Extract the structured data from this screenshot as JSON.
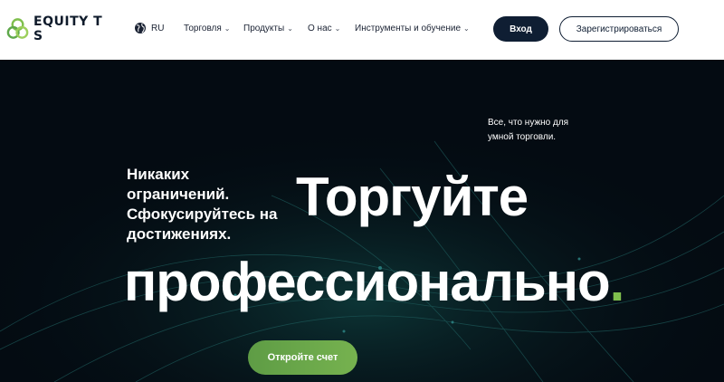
{
  "header": {
    "logo_text": "EQUITY T S",
    "language": "RU",
    "nav": [
      {
        "label": "Торговля"
      },
      {
        "label": "Продукты"
      },
      {
        "label": "О нас"
      },
      {
        "label": "Инструменты и обучение"
      }
    ],
    "login_label": "Вход",
    "register_label": "Зарегистрироваться"
  },
  "hero": {
    "side_text": "Все, что нужно для умной торговли.",
    "subtitle": "Никаких ограничений. Сфокусируйтесь на достижениях.",
    "title_line1": "Торгуйте",
    "title_line2": "профессионально",
    "title_dot": ".",
    "cta_label": "Откройте счет"
  },
  "colors": {
    "brand_dark": "#0f1e33",
    "accent_green": "#7fbf4d",
    "hero_bg": "#040b12"
  }
}
